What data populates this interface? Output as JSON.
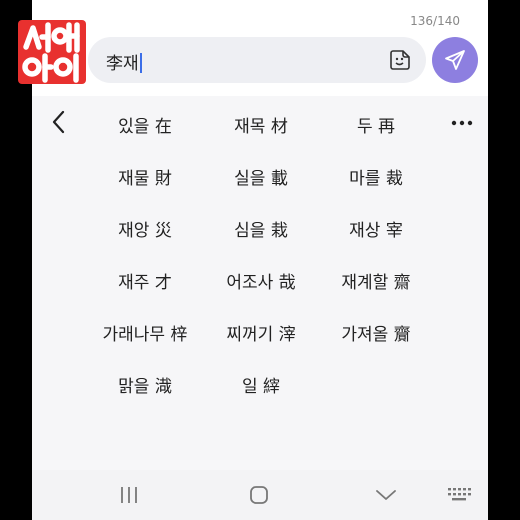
{
  "header": {
    "char_count": "136/140",
    "input_value": "李재",
    "emoji_icon": "sticker-smile-icon",
    "send_icon": "send-paper-plane-icon"
  },
  "logo": {
    "text": "서예아이",
    "color": "#e8312f"
  },
  "keyboard": {
    "back_icon": "chevron-left-icon",
    "more_icon": "more-horizontal-icon",
    "candidates": [
      "있을 在",
      "재목 材",
      "두 再",
      "재물 財",
      "실을 載",
      "마를 裁",
      "재앙 災",
      "심을 栽",
      "재상 宰",
      "재주 才",
      "어조사 哉",
      "재계할 齋",
      "가래나무 梓",
      "찌꺼기 滓",
      "가져올 齎",
      "맑을 渽",
      "일 縡"
    ]
  },
  "navbar": {
    "recents_icon": "recents-icon",
    "home_icon": "home-icon",
    "back_icon": "chevron-down-icon",
    "keyboard_icon": "keyboard-icon"
  }
}
